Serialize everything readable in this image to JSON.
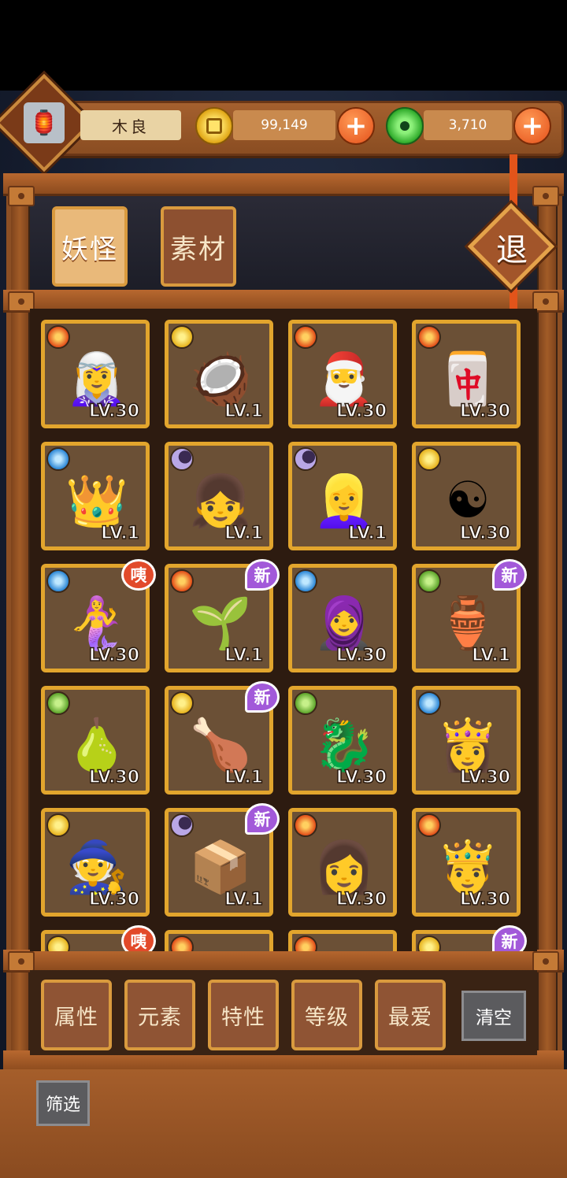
{
  "player": {
    "name": "木良",
    "avatar_icon": "lantern-icon",
    "gold": "99,149",
    "jade": "3,710",
    "gold_icon": "gold-coin-icon",
    "jade_icon": "jade-coin-icon"
  },
  "tabs": [
    {
      "label": "妖怪",
      "active": true
    },
    {
      "label": "素材",
      "active": false
    }
  ],
  "exit_label": "退",
  "cards": [
    {
      "element": "fire",
      "level": "LV.30",
      "char": "🧝‍♀️",
      "badge": ""
    },
    {
      "element": "sun",
      "level": "LV.1",
      "char": "🥥",
      "badge": ""
    },
    {
      "element": "fire",
      "level": "LV.30",
      "char": "🎅",
      "badge": ""
    },
    {
      "element": "fire",
      "level": "LV.30",
      "char": "🀄",
      "badge": ""
    },
    {
      "element": "water",
      "level": "LV.1",
      "char": "👑",
      "badge": ""
    },
    {
      "element": "moon",
      "level": "LV.1",
      "char": "👧",
      "badge": ""
    },
    {
      "element": "moon",
      "level": "LV.1",
      "char": "👱‍♀️",
      "badge": ""
    },
    {
      "element": "sun",
      "level": "LV.30",
      "char": "☯",
      "badge": ""
    },
    {
      "element": "water",
      "level": "LV.30",
      "char": "🧜‍♀️",
      "badge": "咦"
    },
    {
      "element": "fire",
      "level": "LV.1",
      "char": "🌱",
      "badge": "新"
    },
    {
      "element": "water",
      "level": "LV.30",
      "char": "🧕",
      "badge": ""
    },
    {
      "element": "leaf",
      "level": "LV.1",
      "char": "🏺",
      "badge": "新"
    },
    {
      "element": "leaf",
      "level": "LV.30",
      "char": "🍐",
      "badge": ""
    },
    {
      "element": "sun",
      "level": "LV.1",
      "char": "🍗",
      "badge": "新"
    },
    {
      "element": "leaf",
      "level": "LV.30",
      "char": "🐉",
      "badge": ""
    },
    {
      "element": "water",
      "level": "LV.30",
      "char": "👸",
      "badge": ""
    },
    {
      "element": "sun",
      "level": "LV.30",
      "char": "🧙",
      "badge": ""
    },
    {
      "element": "moon",
      "level": "LV.1",
      "char": "📦",
      "badge": "新"
    },
    {
      "element": "fire",
      "level": "LV.30",
      "char": "👩",
      "badge": ""
    },
    {
      "element": "fire",
      "level": "LV.30",
      "char": "🤴",
      "badge": ""
    },
    {
      "element": "sun",
      "level": "",
      "char": "",
      "badge": "咦"
    },
    {
      "element": "fire",
      "level": "",
      "char": "",
      "badge": ""
    },
    {
      "element": "fire",
      "level": "",
      "char": "",
      "badge": ""
    },
    {
      "element": "sun",
      "level": "",
      "char": "",
      "badge": "新"
    }
  ],
  "filters": [
    "属性",
    "元素",
    "特性",
    "等级",
    "最爱"
  ],
  "clear_label": "清空",
  "screen_label": "筛选",
  "colors": {
    "wood": "#8c4f24",
    "gold_border": "#e2a52d",
    "new_badge": "#a259d9",
    "alert_badge": "#e24a2a",
    "plus_button": "#e4501a"
  }
}
